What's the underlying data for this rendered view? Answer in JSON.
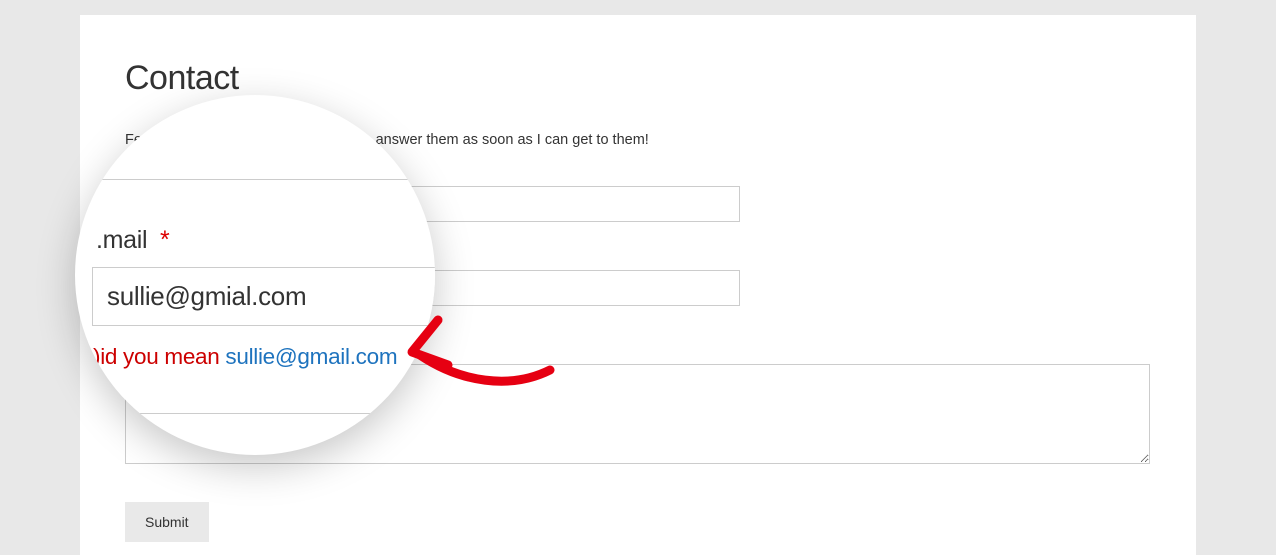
{
  "page": {
    "title": "Contact",
    "intro_left": "Feel fr",
    "intro_right": "answer them as soon as I can get to them!"
  },
  "form": {
    "submit_label": "Submit"
  },
  "loupe": {
    "label_fragment": ".mail",
    "required_mark": "*",
    "email_value": "sullie@gmial.com",
    "hint_prefix": ")id you mean",
    "hint_link": "sullie@gmail.com"
  }
}
